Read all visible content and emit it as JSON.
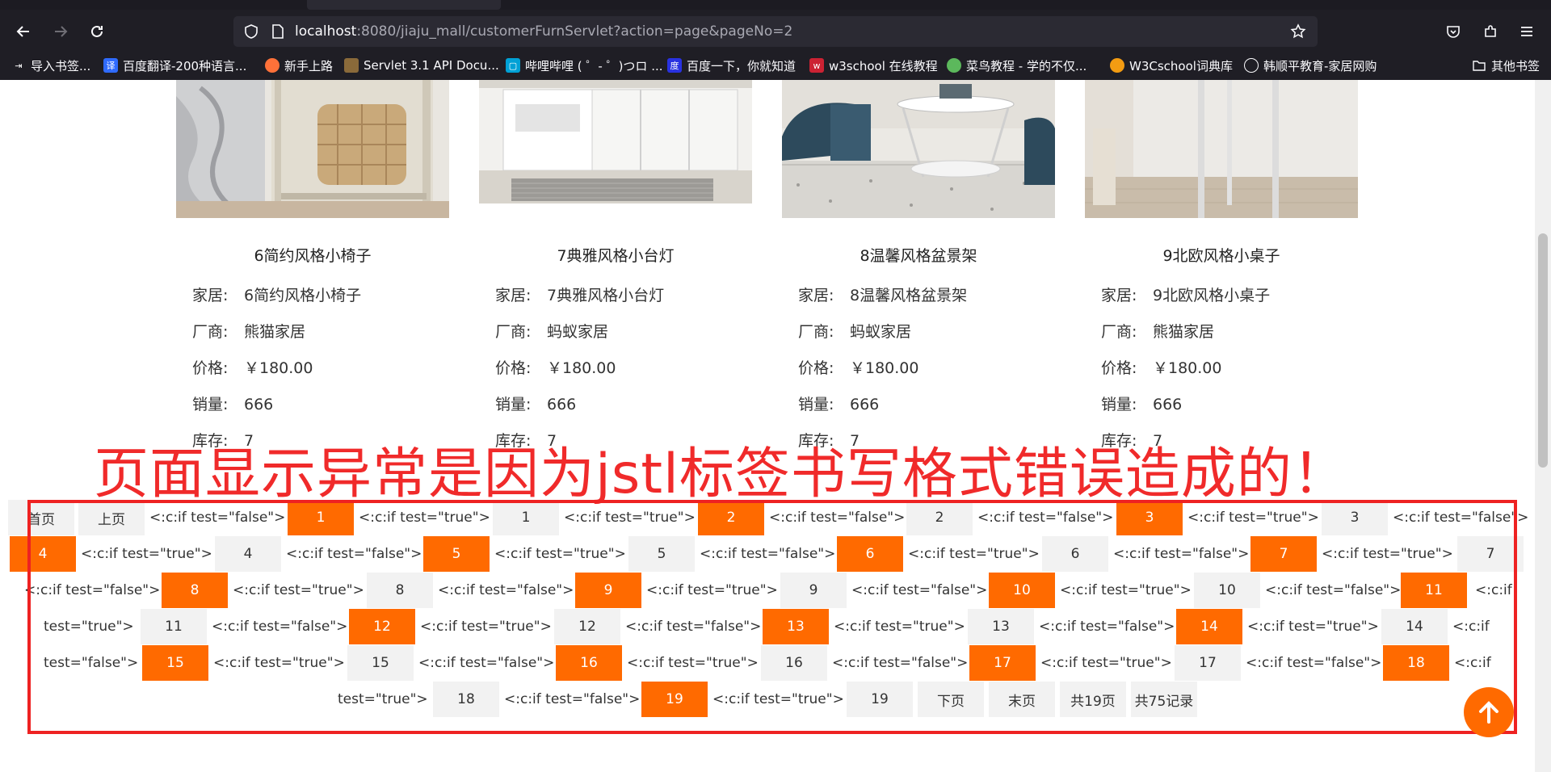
{
  "browser": {
    "url_host": "localhost",
    "url_rest": ":8080/jiaju_mall/customerFurnServlet?action=page&pageNo=2",
    "bookmarks": [
      {
        "label": "导入书签...",
        "icon": "import-icon",
        "color": "#1f1e25"
      },
      {
        "label": "百度翻译-200种语言...",
        "icon": "baidu-translate-icon",
        "color": "#2f6bff"
      },
      {
        "label": "新手上路",
        "icon": "firefox-icon",
        "color": "#ff7139"
      },
      {
        "label": "Servlet 3.1 API Docu...",
        "icon": "doc-icon",
        "color": "#8a6a3a"
      },
      {
        "label": "哔哩哔哩 ( ゜- ゜)つロ ...",
        "icon": "bilibili-icon",
        "color": "#00a1d6"
      },
      {
        "label": "百度一下，你就知道",
        "icon": "baidu-icon",
        "color": "#2932e1"
      },
      {
        "label": "w3school 在线教程",
        "icon": "w3school-icon",
        "color": "#cc2233"
      },
      {
        "label": "菜鸟教程 - 学的不仅...",
        "icon": "runoob-icon",
        "color": "#5cb85c"
      },
      {
        "label": "W3Cschool词典库",
        "icon": "w3cschool-icon",
        "color": "#f39c12"
      },
      {
        "label": "韩顺平教育-家居网购",
        "icon": "globe-icon",
        "color": "#1f1e25"
      },
      {
        "label": "其他书签",
        "icon": "folder-icon",
        "color": "#1f1e25"
      }
    ]
  },
  "products": [
    {
      "name": "6简约风格小椅子",
      "rows": [
        {
          "label": "家居:",
          "value": "6简约风格小椅子"
        },
        {
          "label": "厂商:",
          "value": "熊猫家居"
        },
        {
          "label": "价格:",
          "value": "￥180.00"
        },
        {
          "label": "销量:",
          "value": "666"
        },
        {
          "label": "库存:",
          "value": "7"
        }
      ]
    },
    {
      "name": "7典雅风格小台灯",
      "rows": [
        {
          "label": "家居:",
          "value": "7典雅风格小台灯"
        },
        {
          "label": "厂商:",
          "value": "蚂蚁家居"
        },
        {
          "label": "价格:",
          "value": "￥180.00"
        },
        {
          "label": "销量:",
          "value": "666"
        },
        {
          "label": "库存:",
          "value": "7"
        }
      ]
    },
    {
      "name": "8温馨风格盆景架",
      "rows": [
        {
          "label": "家居:",
          "value": "8温馨风格盆景架"
        },
        {
          "label": "厂商:",
          "value": "蚂蚁家居"
        },
        {
          "label": "价格:",
          "value": "￥180.00"
        },
        {
          "label": "销量:",
          "value": "666"
        },
        {
          "label": "库存:",
          "value": "7"
        }
      ]
    },
    {
      "name": "9北欧风格小桌子",
      "rows": [
        {
          "label": "家居:",
          "value": "9北欧风格小桌子"
        },
        {
          "label": "厂商:",
          "value": "熊猫家居"
        },
        {
          "label": "价格:",
          "value": "￥180.00"
        },
        {
          "label": "销量:",
          "value": "666"
        },
        {
          "label": "库存:",
          "value": "7"
        }
      ]
    }
  ],
  "annotation": "页面显示异常是因为jstl标签书写格式错误造成的！",
  "pager": {
    "first": "首页",
    "prev": "上页",
    "next": "下页",
    "last": "末页",
    "total_pages": "共19页",
    "total_records": "共75记录",
    "tag_false": "<:c:if test=\"false\">",
    "tag_true": "<:c:if test=\"true\">",
    "tag_wrap_head": "<:c:if",
    "tag_wrap_true": "test=\"true\">",
    "tag_wrap_false": "test=\"false\">",
    "pages": [
      "1",
      "2",
      "3",
      "4",
      "5",
      "6",
      "7",
      "8",
      "9",
      "10",
      "11",
      "12",
      "13",
      "14",
      "15",
      "16",
      "17",
      "18",
      "19"
    ]
  },
  "colors": {
    "accent": "#ff6a00",
    "annotation": "#f02a2a"
  }
}
